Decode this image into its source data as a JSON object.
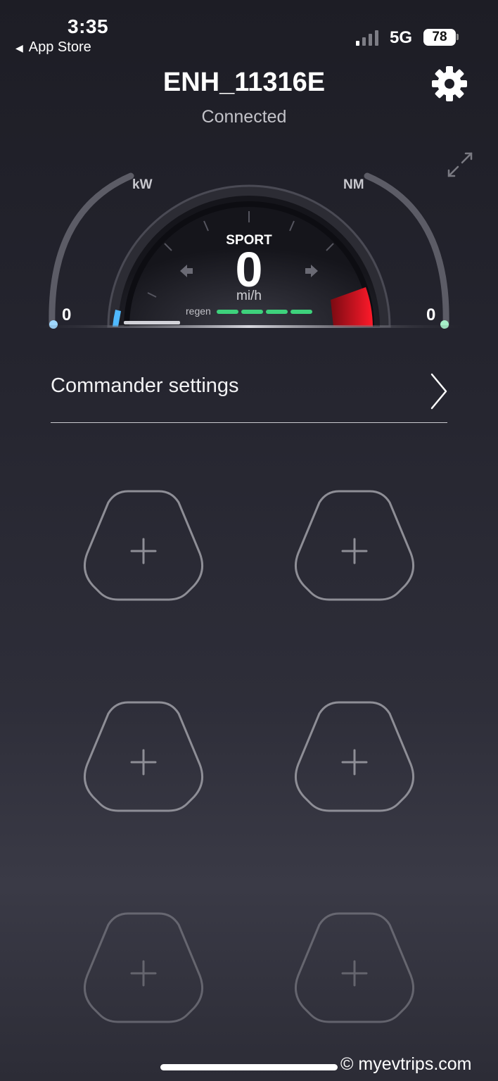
{
  "status_bar": {
    "time": "3:35",
    "back_label": "App Store",
    "network": "5G",
    "battery": "78"
  },
  "header": {
    "device_name": "ENH_11316E",
    "connection_status": "Connected"
  },
  "gauge": {
    "power_unit": "kW",
    "power_value": "0",
    "torque_unit": "NM",
    "torque_value": "0",
    "mode": "SPORT",
    "speed": "0",
    "speed_unit": "mi/h",
    "regen_label": "regen",
    "regen_segments": 4
  },
  "settings": {
    "commander_label": "Commander settings"
  },
  "slots": {
    "count": 6
  },
  "watermark": "© myevtrips.com",
  "colors": {
    "background": "#25252f",
    "regen_green": "#3ed17c",
    "redline": "#e01b24",
    "slot_outline": "#8e8e96"
  }
}
